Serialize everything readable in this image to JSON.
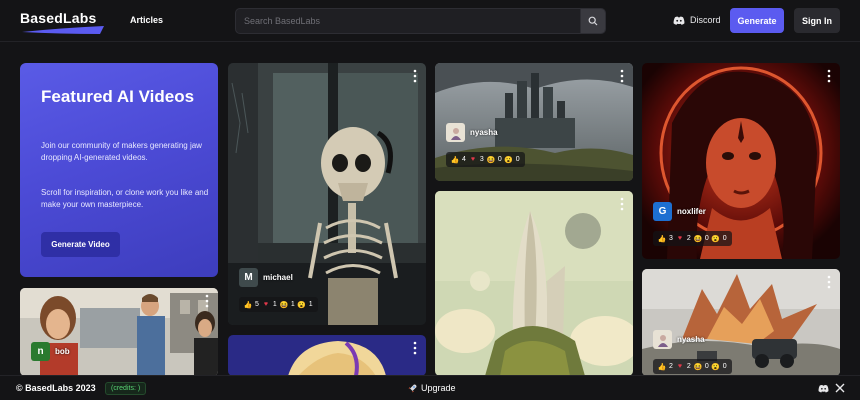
{
  "header": {
    "logo_text": "BasedLabs",
    "nav_articles": "Articles",
    "search_placeholder": "Search BasedLabs",
    "discord_label": "Discord",
    "generate_label": "Generate",
    "signin_label": "Sign In"
  },
  "featured": {
    "title": "Featured AI Videos",
    "paragraph1": "Join our community of makers generating jaw dropping AI-generated videos.",
    "paragraph2": "Scroll for inspiration, or clone work you like and make your own masterpiece.",
    "button_label": "Generate Video"
  },
  "cards": {
    "skeleton": {
      "user": "michael",
      "avatar_letter": "M",
      "reactions": {
        "like": "5",
        "heart": "1",
        "laugh": "1",
        "wow": "1"
      }
    },
    "city": {
      "user": "nyasha",
      "reactions": {
        "like": "4",
        "heart": "3",
        "laugh": "0",
        "wow": "0"
      }
    },
    "redwoman": {
      "user": "noxlifer",
      "avatar_letter": "G",
      "reactions": {
        "like": "3",
        "heart": "2",
        "laugh": "0",
        "wow": "0"
      }
    },
    "crowd": {
      "user": "bob",
      "avatar_letter": "n"
    },
    "explosion": {
      "user": "nyasha",
      "reactions": {
        "like": "2",
        "heart": "2",
        "laugh": "0",
        "wow": "0"
      }
    }
  },
  "footer": {
    "copyright": "© BasedLabs 2023",
    "credits_label": "(credits: )",
    "upgrade_label": "Upgrade"
  },
  "colors": {
    "accent": "#5b5bf0",
    "background": "#141416",
    "featured_gradient_start": "#5a5be6",
    "credits_green": "#58d172"
  },
  "icons": [
    "search-icon",
    "discord-icon",
    "more-vertical-icon",
    "thumbs-up-icon",
    "heart-icon",
    "laugh-icon",
    "wow-icon",
    "rocket-icon",
    "x-logo-icon"
  ]
}
